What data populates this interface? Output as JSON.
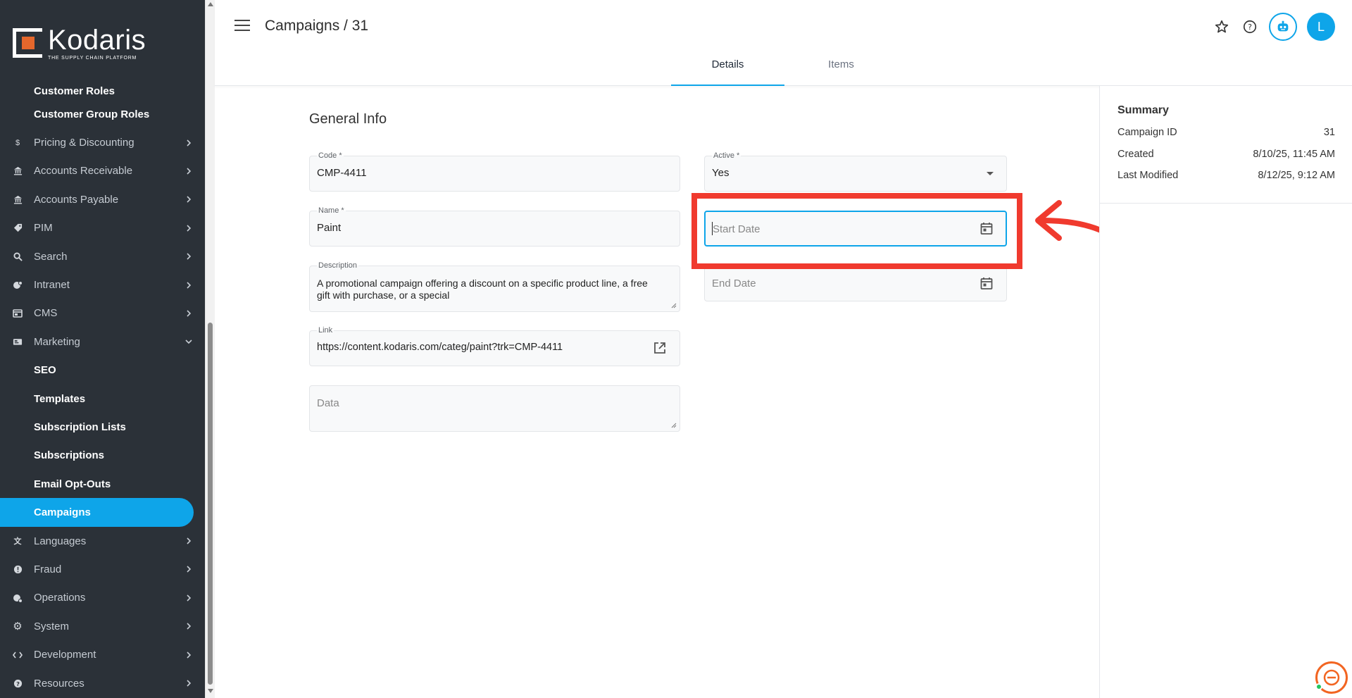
{
  "brand": {
    "name": "Kodaris",
    "tagline": "THE SUPPLY CHAIN PLATFORM",
    "accent": "#e5672c"
  },
  "sidebar": {
    "top_items": [
      {
        "label": "Customer Roles"
      },
      {
        "label": "Customer Group Roles"
      }
    ],
    "items_before_marketing": [
      {
        "label": "Pricing & Discounting",
        "icon": "dollar-icon"
      },
      {
        "label": "Accounts Receivable",
        "icon": "bank-icon"
      },
      {
        "label": "Accounts Payable",
        "icon": "bank-icon"
      },
      {
        "label": "PIM",
        "icon": "tag-icon"
      },
      {
        "label": "Search",
        "icon": "search-icon"
      },
      {
        "label": "Intranet",
        "icon": "intranet-icon"
      },
      {
        "label": "CMS",
        "icon": "cms-icon"
      }
    ],
    "marketing": {
      "label": "Marketing",
      "icon": "marketing-icon"
    },
    "marketing_children": [
      {
        "label": "SEO"
      },
      {
        "label": "Templates"
      },
      {
        "label": "Subscription Lists"
      },
      {
        "label": "Subscriptions"
      },
      {
        "label": "Email Opt-Outs"
      },
      {
        "label": "Campaigns"
      }
    ],
    "items_after_marketing": [
      {
        "label": "Languages",
        "icon": "translate-icon"
      },
      {
        "label": "Fraud",
        "icon": "alert-icon"
      },
      {
        "label": "Operations",
        "icon": "operations-icon"
      },
      {
        "label": "System",
        "icon": "gear-icon"
      },
      {
        "label": "Development",
        "icon": "code-icon"
      },
      {
        "label": "Resources",
        "icon": "help-icon"
      }
    ],
    "active_color": "#0ea5e9"
  },
  "header": {
    "breadcrumb": "Campaigns / 31",
    "avatar_initial": "L",
    "tabs": [
      {
        "label": "Details",
        "active": true
      },
      {
        "label": "Items",
        "active": false
      }
    ]
  },
  "form": {
    "section_title": "General Info",
    "code": {
      "label": "Code *",
      "value": "CMP-4411"
    },
    "name": {
      "label": "Name *",
      "value": "Paint"
    },
    "description": {
      "label": "Description",
      "value": "A promotional campaign offering a discount on a specific product line, a free gift with purchase, or a special"
    },
    "link": {
      "label": "Link",
      "value": "https://content.kodaris.com/categ/paint?trk=CMP-4411"
    },
    "data": {
      "placeholder": "Data"
    },
    "active": {
      "label": "Active *",
      "value": "Yes"
    },
    "start_date": {
      "placeholder": "Start Date"
    },
    "end_date": {
      "placeholder": "End Date"
    }
  },
  "summary": {
    "title": "Summary",
    "rows": [
      {
        "label": "Campaign ID",
        "value": "31"
      },
      {
        "label": "Created",
        "value": "8/10/25, 11:45 AM"
      },
      {
        "label": "Last Modified",
        "value": "8/12/25, 9:12 AM"
      }
    ]
  },
  "annotation": {
    "color": "#f03a2e"
  }
}
